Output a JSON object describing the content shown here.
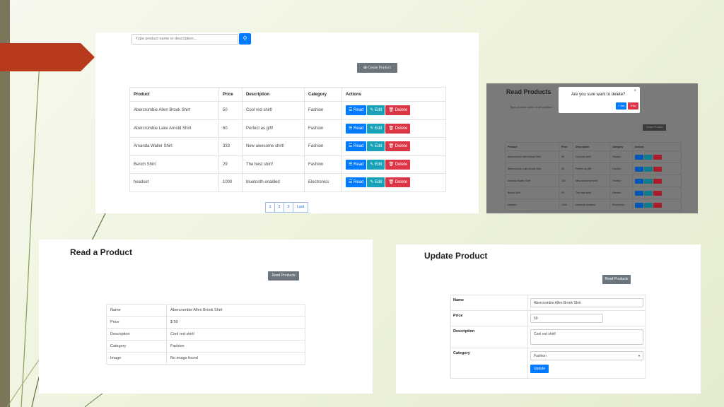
{
  "main": {
    "search_placeholder": "Type product name or description...",
    "create_label": "Create Product",
    "headers": [
      "Product",
      "Price",
      "Description",
      "Category",
      "Actions"
    ],
    "rows": [
      {
        "product": "Abercrombie Allen Brook Shirt",
        "price": "50",
        "description": "Cool red shirt!",
        "category": "Fashion"
      },
      {
        "product": "Abercrombie Lake Arnold Shirt",
        "price": "60",
        "description": "Perfect as gift!",
        "category": "Fashion"
      },
      {
        "product": "Amanda Waller Shirt",
        "price": "333",
        "description": "New awesome shirt!",
        "category": "Fashion"
      },
      {
        "product": "Bench Shirt",
        "price": "29",
        "description": "The best shirt!",
        "category": "Fashion"
      },
      {
        "product": "headset",
        "price": "1000",
        "description": "bluetooth enabled",
        "category": "Electronics"
      }
    ],
    "actions": {
      "read": "Read",
      "edit": "Edit",
      "delete": "Delete"
    },
    "pagination": [
      "1",
      "2",
      "3",
      "Last"
    ]
  },
  "modal_view": {
    "title": "Read Products",
    "search_placeholder": "Type product name or description...",
    "dialog": {
      "question": "Are you sure want to delete?",
      "yes": "Yes",
      "no": "No"
    },
    "create_label": "Create Product",
    "headers": [
      "Product",
      "Price",
      "Description",
      "Category",
      "Actions"
    ],
    "rows": [
      {
        "product": "Abercrombie Allen Brook Shirt",
        "price": "50",
        "description": "Cool red shirt!",
        "category": "Fashion"
      },
      {
        "product": "Abercrombie Lake Arnold Shirt",
        "price": "60",
        "description": "Perfect as gift!",
        "category": "Fashion"
      },
      {
        "product": "Amanda Waller Shirt",
        "price": "333",
        "description": "New awesome shirt!",
        "category": "Fashion"
      },
      {
        "product": "Bench Shirt",
        "price": "29",
        "description": "The best shirt!",
        "category": "Fashion"
      },
      {
        "product": "headset",
        "price": "1000",
        "description": "bluetooth enabled",
        "category": "Electronics"
      }
    ]
  },
  "read_product": {
    "title": "Read a Product",
    "button": "Read Products",
    "rows": [
      {
        "label": "Name",
        "value": "Abercrombie Allen Brook Shirt"
      },
      {
        "label": "Price",
        "value": "$ 50"
      },
      {
        "label": "Description",
        "value": "Cool red shirt!"
      },
      {
        "label": "Category",
        "value": "Fashion"
      },
      {
        "label": "Image",
        "value": "No image found"
      }
    ]
  },
  "update_product": {
    "title": "Update Product",
    "button": "Read Products",
    "fields": {
      "name_label": "Name",
      "name_value": "Abercrombie Allen Brook Shirt",
      "price_label": "Price",
      "price_value": "50",
      "description_label": "Description",
      "description_value": "Cool red shirt!",
      "category_label": "Category",
      "category_value": "Fashion"
    },
    "submit": "Update"
  },
  "colors": {
    "primary": "#007bff",
    "info": "#17a2b8",
    "danger": "#dc3545",
    "secondary": "#6c757d",
    "slide_accent": "#b83a1c"
  }
}
